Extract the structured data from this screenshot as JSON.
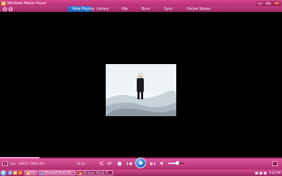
{
  "window": {
    "title": "Windows Media Player"
  },
  "window_buttons": [
    {
      "name": "minimize-button",
      "glyph": "_"
    },
    {
      "name": "maximize-button",
      "glyph": "□"
    },
    {
      "name": "close-button",
      "glyph": "×"
    }
  ],
  "nav": {
    "tabs": [
      {
        "label": "Now Playing",
        "active": true
      },
      {
        "label": "Library",
        "active": false
      },
      {
        "label": "Rip",
        "active": false
      },
      {
        "label": "Burn",
        "active": false
      },
      {
        "label": "Sync",
        "active": false
      },
      {
        "label": "Online Stores",
        "active": false
      }
    ]
  },
  "player": {
    "track_title": "Kiki – SWEET CREW (PV)",
    "elapsed": "00:26",
    "seek_progress": 0.14,
    "volume_level": 0.55
  },
  "taskbar": {
    "buttons": [
      {
        "label": "Kiki",
        "active": false,
        "color": "#ffd75a"
      },
      {
        "label": "Microsoft Photo Ed...",
        "active": false,
        "color": "#5fa8e8"
      },
      {
        "label": "Windows Media Pl...",
        "active": true,
        "color": "#ff9a3c"
      }
    ],
    "clock": "9:40 PM"
  },
  "colors": {
    "accent": "#c03a80",
    "active_tab": "#2a74cc"
  }
}
